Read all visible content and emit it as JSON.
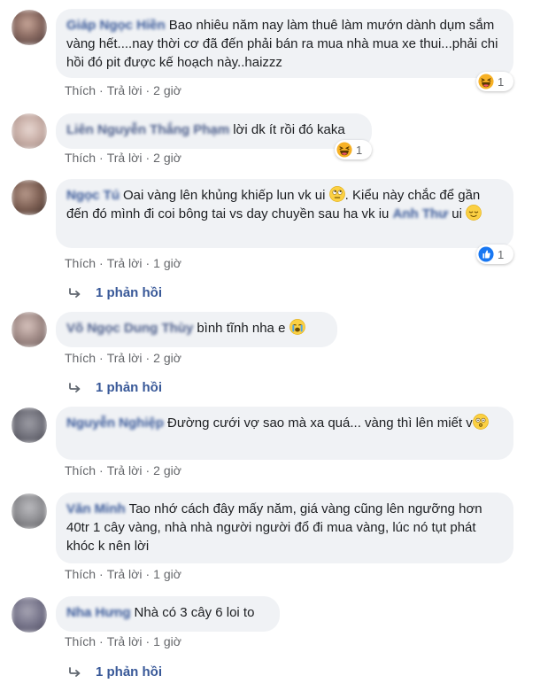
{
  "labels": {
    "like": "Thích",
    "reply": "Trả lời",
    "dot": "·"
  },
  "comments": [
    {
      "author": "Giáp Ngọc Hiền",
      "text": "Bao nhiêu năm nay làm thuê làm mướn dành dụm sắm vàng hết....nay thời cơ đã đến phải bán ra mua nhà mua xe thui...phải chi hồi đó pit được kế hoạch này..haizzz",
      "time": "2 giờ",
      "reaction": {
        "type": "haha",
        "count": "1"
      }
    },
    {
      "author": "Liên Nguyễn Thắng Phạm",
      "text": "lời dk ít rồi đó kaka",
      "time": "2 giờ",
      "reaction": {
        "type": "haha",
        "count": "1"
      }
    },
    {
      "author": "Ngọc Tú",
      "text_1": "Oai vàng lên khủng khiếp lun vk ui ",
      "text_2": ". Kiểu này chắc để gần đến đó mình đi coi bông tai vs day chuyền sau ha vk iu ",
      "mention": "Anh Thư",
      "text_3": " ui ",
      "time": "1 giờ",
      "reaction": {
        "type": "like",
        "count": "1"
      },
      "replies": "1 phản hồi"
    },
    {
      "author": "Võ Ngọc Dung Thùy",
      "text": "bình tĩnh nha e ",
      "time": "2 giờ",
      "replies": "1 phản hồi"
    },
    {
      "author": "Nguyễn Nghiệp",
      "text": "Đường cưới vợ sao mà xa quá... vàng thì lên miết v",
      "time": "2 giờ"
    },
    {
      "author": "Văn Minh",
      "text": "Tao nhớ cách đây mấy năm, giá vàng cũng lên ngưỡng hơn 40tr 1 cây vàng, nhà nhà người người đổ đi mua vàng, lúc nó tụt phát khóc k nên lời",
      "time": "1 giờ"
    },
    {
      "author": "Nha Hưng",
      "text": "Nhà có 3 cây 6 loi to",
      "time": "1 giờ",
      "replies": "1 phản hồi"
    }
  ],
  "colors": {
    "bubble": "#f0f2f5",
    "author": "#385898",
    "meta": "#65676b",
    "haha": "#f7b125",
    "like": "#1877f2"
  },
  "icons": [
    "haha-reaction-icon",
    "like-reaction-icon",
    "reply-arrow-icon",
    "rolling-eyes-emoji",
    "relieved-emoji",
    "crying-emoji",
    "dizzy-emoji"
  ]
}
